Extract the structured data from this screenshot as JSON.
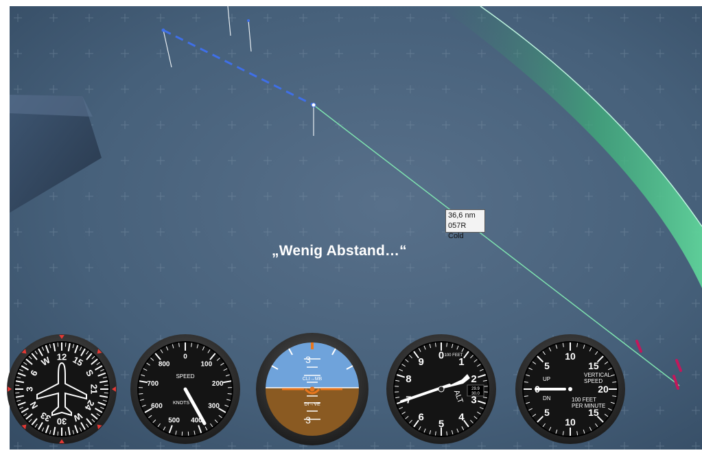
{
  "route_label": {
    "distance": "36,6 nm",
    "waypoint": "057R Cold"
  },
  "caption": "„Wenig Abstand…“",
  "instruments": {
    "heading_indicator": {
      "labels": [
        "N",
        "3",
        "6",
        "W",
        "12",
        "15",
        "S",
        "21",
        "24",
        "W",
        "30",
        "33"
      ]
    },
    "airspeed_indicator": {
      "title": "SPEED",
      "unit": "KNOTS",
      "ticks": [
        "0",
        "100",
        "200",
        "300",
        "400",
        "500",
        "600",
        "700",
        "800"
      ]
    },
    "attitude_indicator": {
      "top_label": "CLI→MB",
      "bottom_label": "DI→VE",
      "pitch_labels": [
        "3",
        "3"
      ]
    },
    "altimeter": {
      "unit": "100 FEET",
      "label": "ALT",
      "ticks": [
        "0",
        "1",
        "2",
        "3",
        "4",
        "5",
        "6",
        "7",
        "8",
        "9"
      ],
      "kollsman": [
        "29.9",
        "30.0"
      ]
    },
    "vertical_speed_indicator": {
      "title": "VERTICAL",
      "title2": "SPEED",
      "up": "UP",
      "down": "DN",
      "unit": "100 FEET",
      "unit2": "PER MINUTE",
      "ticks": [
        "0",
        "5",
        "10",
        "15",
        "20",
        "15",
        "10",
        "5"
      ]
    }
  },
  "colors": {
    "sky": "#4a627a",
    "route_solid": "#7fe3b0",
    "route_dashed": "#3f6fe8",
    "warning_markers": "#c2185b",
    "attitude_sky": "#6fa3db",
    "attitude_ground": "#8a5a22"
  }
}
